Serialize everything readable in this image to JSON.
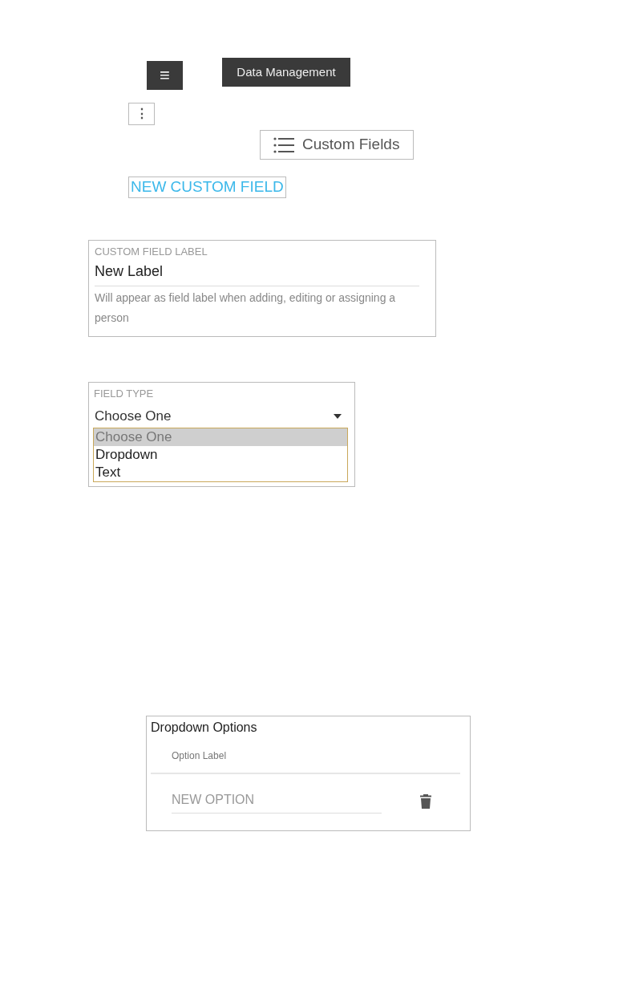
{
  "toolbar": {
    "menu_button": "≡",
    "title_button": "Data Management"
  },
  "kebab_button": "⋮",
  "custom_fields_button": {
    "label": "Custom Fields"
  },
  "new_custom_field_link": "NEW CUSTOM FIELD",
  "custom_field_label": {
    "label": "CUSTOM FIELD LABEL",
    "value": "New Label",
    "help": "Will appear as field label when adding, editing or assigning a person"
  },
  "field_type": {
    "label": "FIELD TYPE",
    "value": "Choose One",
    "options": [
      {
        "label": "Choose One",
        "selected": true
      },
      {
        "label": "Dropdown",
        "selected": false
      },
      {
        "label": "Text",
        "selected": false
      }
    ]
  },
  "dropdown_options": {
    "title": "Dropdown Options",
    "column": "Option Label",
    "placeholder": "NEW OPTION"
  }
}
